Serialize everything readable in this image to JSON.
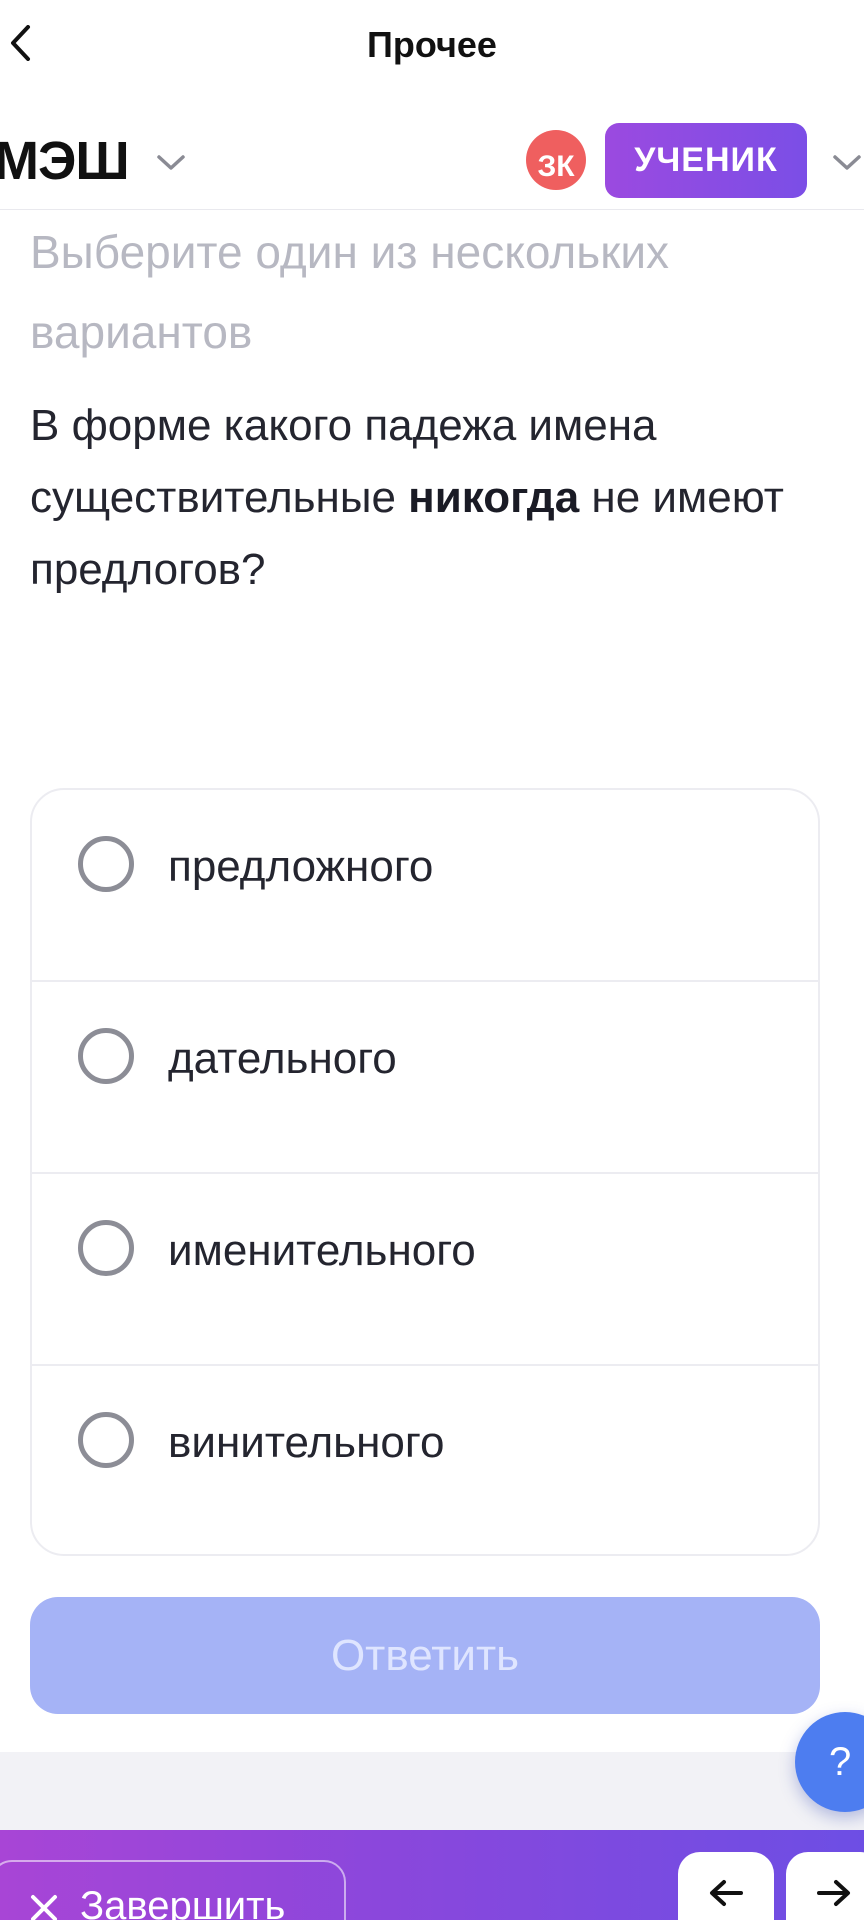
{
  "navbar": {
    "title": "Прочее",
    "back_icon": "chevron-left-icon"
  },
  "header": {
    "brand": "МЭШ",
    "brand_chevron_icon": "chevron-down-icon",
    "avatar_initials": "ЗК",
    "avatar_color": "#ef5f5f",
    "role_label": "УЧЕНИК",
    "role_color": "#8b4ae3",
    "role_chevron_icon": "chevron-down-icon"
  },
  "question": {
    "instruction": "Выберите один из нескольких вариантов",
    "text_before": "В форме какого падежа имена существительные ",
    "text_bold": "никогда",
    "text_after": " не имеют предлогов?"
  },
  "options": [
    {
      "label": "предложного",
      "selected": false
    },
    {
      "label": "дательного",
      "selected": false
    },
    {
      "label": "именительного",
      "selected": false
    },
    {
      "label": "винительного",
      "selected": false
    }
  ],
  "answer_button": {
    "label": "Ответить",
    "enabled": false,
    "color": "#a5b3f6"
  },
  "help": {
    "label": "?",
    "color": "#4d7df0"
  },
  "footer": {
    "finish_label": "Завершить",
    "finish_icon": "close-icon",
    "prev_icon": "arrow-left-icon",
    "next_icon": "arrow-right-icon"
  }
}
